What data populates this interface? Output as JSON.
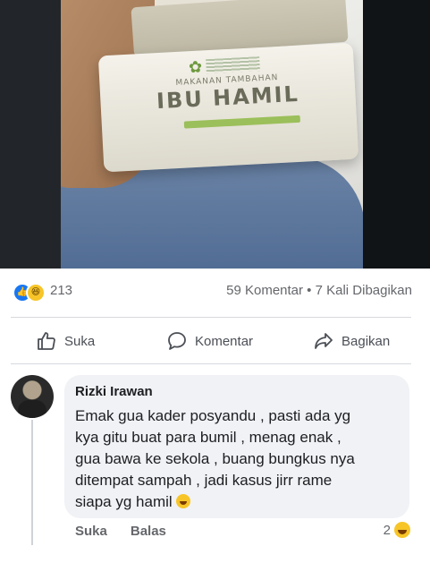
{
  "post_image": {
    "package_line1": "MAKANAN TAMBAHAN",
    "package_line2": "IBU HAMIL"
  },
  "stats": {
    "reaction_count": "213",
    "comments_and_shares": "59 Komentar • 7 Kali Dibagikan"
  },
  "actions": {
    "like": "Suka",
    "comment": "Komentar",
    "share": "Bagikan"
  },
  "comment": {
    "author": "Rizki Irawan",
    "text": "Emak gua kader posyandu , pasti ada yg\nkya gitu buat para bumil , menag enak ,\ngua bawa ke sekola , buang bungkus nya\nditempat sampah , jadi kasus jirr rame\nsiapa yg hamil",
    "like_label": "Suka",
    "reply_label": "Balas",
    "reaction_count": "2"
  },
  "colors": {
    "accent_blue": "#1877f2",
    "haha_yellow": "#f7c528",
    "muted_text": "#65676b",
    "bubble_bg": "#f0f2f5"
  }
}
